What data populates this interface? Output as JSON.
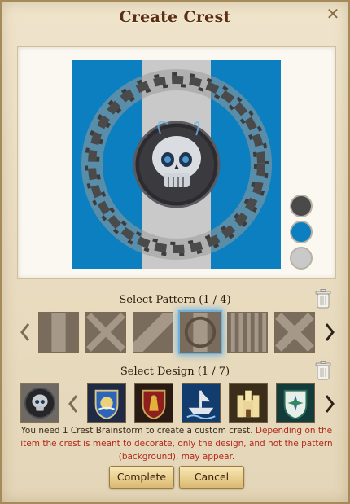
{
  "window": {
    "title": "Create Crest",
    "close_label": "✕"
  },
  "preview": {
    "colors": {
      "background": "#0b7fbf",
      "stripe": "#c9c9c9",
      "ring": "#4a4a4a"
    },
    "swatches": [
      {
        "name": "dark-gray",
        "color": "#4a4a4a"
      },
      {
        "name": "blue",
        "color": "#0b7fbf"
      },
      {
        "name": "light-gray",
        "color": "#c9c9c9"
      }
    ]
  },
  "pattern": {
    "label": "Select Pattern (1 / 4)",
    "tiles": [
      "pale-stripe",
      "saltire",
      "bend",
      "circle-stripes",
      "paly",
      "saltire-2"
    ],
    "selected_index": 3
  },
  "design": {
    "label": "Select Design (1 / 7)",
    "current": "skull-icon",
    "tiles": [
      "ship-shield-icon",
      "lion-shield-icon",
      "longship-icon",
      "castle-icon",
      "compass-shield-icon"
    ]
  },
  "info": {
    "normal": "You need 1 Crest Brainstorm to create a custom crest.",
    "warning": "Depending on the item the crest is meant to decorate, only the design, and not the pattern (background), may appear."
  },
  "buttons": {
    "complete": "Complete",
    "cancel": "Cancel"
  }
}
